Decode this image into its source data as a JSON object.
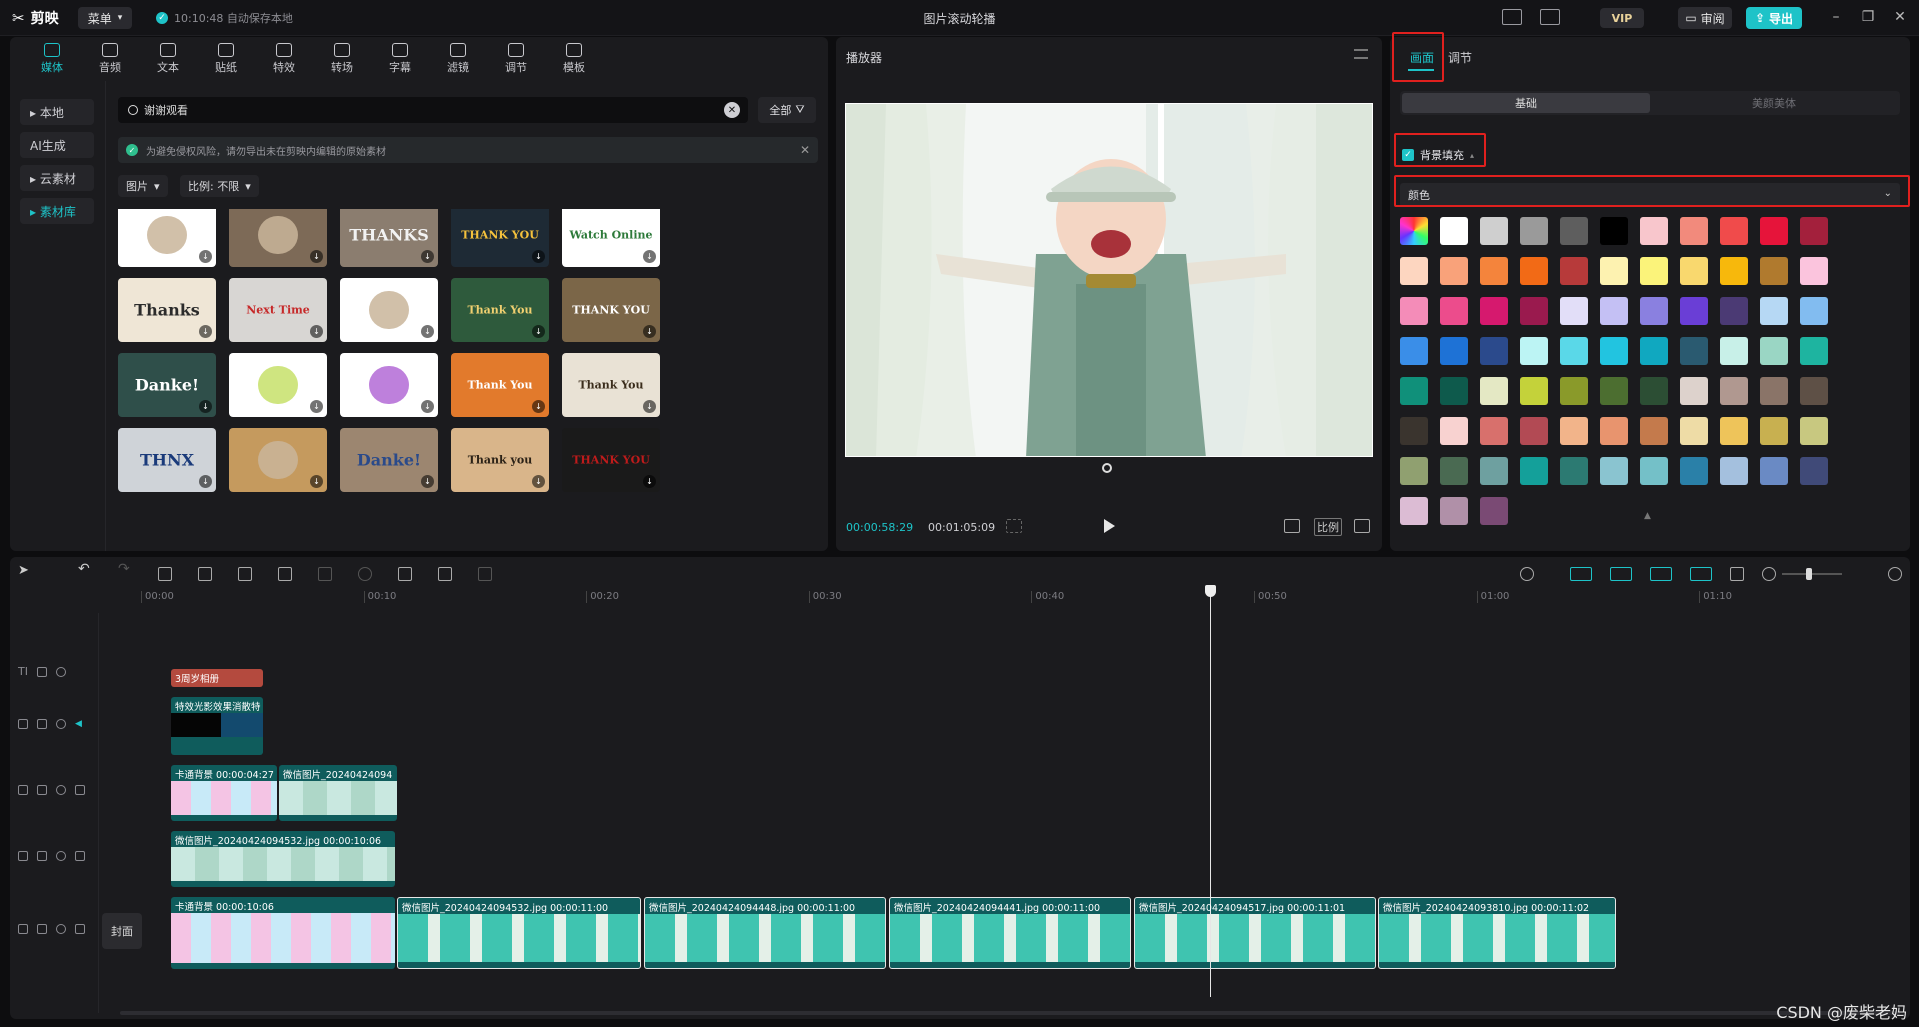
{
  "app": {
    "name": "剪映",
    "menu_label": "菜单",
    "autosave": "10:10:48 自动保存本地",
    "title": "图片滚动轮播",
    "vip": "VIP",
    "review": "审阅",
    "export": "导出"
  },
  "media": {
    "tabs": [
      {
        "label": "媒体",
        "active": true
      },
      {
        "label": "音频"
      },
      {
        "label": "文本"
      },
      {
        "label": "贴纸"
      },
      {
        "label": "特效"
      },
      {
        "label": "转场"
      },
      {
        "label": "字幕"
      },
      {
        "label": "滤镜"
      },
      {
        "label": "调节"
      },
      {
        "label": "模板"
      }
    ],
    "sidebar": [
      {
        "label": "▸ 本地"
      },
      {
        "label": "AI生成"
      },
      {
        "label": "▸ 云素材"
      },
      {
        "label": "▸ 素材库",
        "active": true
      }
    ],
    "search_value": "谢谢观看",
    "filter_all": "全部",
    "notice": "为避免侵权风险，请勿导出未在剪映内编辑的原始素材",
    "filter_type": "图片",
    "filter_ratio": "比例: 不限",
    "tiles": [
      {
        "text": "",
        "bg": "#ffffff"
      },
      {
        "text": "",
        "bg": "#7d6a57"
      },
      {
        "text": "THANKS",
        "bg": "#8b7d6f"
      },
      {
        "text": "THANK YOU",
        "bg": "#1e2a35"
      },
      {
        "text": "Watch Online",
        "bg": "#ffffff"
      },
      {
        "text": "Thanks",
        "bg": "#efe6d6"
      },
      {
        "text": "Next Time",
        "bg": "#d8d6d3"
      },
      {
        "text": "",
        "bg": "#ffffff"
      },
      {
        "text": "Thank You",
        "bg": "#2e5a3c"
      },
      {
        "text": "THANK YOU",
        "bg": "#7b6648"
      },
      {
        "text": "Danke!",
        "bg": "#2f4f4a"
      },
      {
        "text": "",
        "bg": "#ffffff"
      },
      {
        "text": "",
        "bg": "#ffffff"
      },
      {
        "text": "Thank You",
        "bg": "#e27a2c"
      },
      {
        "text": "Thank You",
        "bg": "#e9e2d5"
      },
      {
        "text": "THNX",
        "bg": "#cfd3d8"
      },
      {
        "text": "",
        "bg": "#c59a5e"
      },
      {
        "text": "Danke!",
        "bg": "#9c8670"
      },
      {
        "text": "Thank you",
        "bg": "#d9b58a"
      },
      {
        "text": "THANK YOU",
        "bg": "#1a1a1a"
      }
    ]
  },
  "player": {
    "title": "播放器",
    "current": "00:00:58:29",
    "total": "00:01:05:09",
    "ratio_label": "比例"
  },
  "props": {
    "tab_picture": "画面",
    "tab_adjust": "调节",
    "seg_basic": "基础",
    "seg_beauty": "美颜美体",
    "bgfill_label": "背景填充",
    "dropdown_value": "颜色",
    "swatches": [
      "#ffffff",
      "#cfcfcf",
      "#9a9a9a",
      "#5e5e5e",
      "#000000",
      "#f8c6cc",
      "#f28a7c",
      "#f04b4b",
      "#e6143a",
      "#a3203c",
      "#fdd6c0",
      "#f9a27a",
      "#f4843c",
      "#f26a16",
      "#b73a3a",
      "#fdf2b0",
      "#fbf37a",
      "#f9d86e",
      "#f7b80c",
      "#b07a2e",
      "#fbc4dd",
      "#f48cb8",
      "#ec4c8c",
      "#d6196e",
      "#9a1a4e",
      "#e2def8",
      "#c4c0f4",
      "#8a80e0",
      "#6a3ed6",
      "#4b3a74",
      "#b6d8f4",
      "#82bcf0",
      "#3a8ee8",
      "#1e72d6",
      "#2b4a8c",
      "#bcf4f4",
      "#5ad8e8",
      "#22c4e0",
      "#10a8c0",
      "#2a5a70",
      "#c8f0e8",
      "#9ad6c4",
      "#1eb4a0",
      "#10907a",
      "#0e5a4c",
      "#e4e8c4",
      "#c4d23a",
      "#8a9a2a",
      "#4c6e30",
      "#2c4e34",
      "#ddd2cc",
      "#b09890",
      "#8a7468",
      "#5e5046",
      "#3a342e",
      "#f8d2d0",
      "#d8706c",
      "#b24a54",
      "#f2b48a",
      "#e8946e",
      "#c47a4c",
      "#eedca6",
      "#eec45a",
      "#c8b050",
      "#c8c880",
      "#90a070",
      "#4a6a52",
      "#6ea0a0",
      "#14a09a",
      "#2c7a72",
      "#8ac4d0",
      "#74c0c8",
      "#2a80a8",
      "#a4c0de",
      "#6a8ac4",
      "#404a78",
      "#dcbcd4",
      "#b090a8",
      "#7a4a74"
    ]
  },
  "timeline": {
    "ruler": [
      "00:00",
      "00:10",
      "00:20",
      "00:30",
      "00:40",
      "00:50",
      "01:00",
      "01:10"
    ],
    "text_clip": "3周岁相册",
    "effect_clip": "特效光影效果消散特",
    "clips_track3": [
      {
        "label": "卡通背景  00:00:04:27"
      },
      {
        "label": "微信图片_20240424094"
      }
    ],
    "clips_track4": [
      {
        "label": "微信图片_20240424094532.jpg  00:00:10:06"
      }
    ],
    "clips_main": [
      {
        "label": "卡通背景  00:00:10:06"
      },
      {
        "label": "微信图片_20240424094532.jpg  00:00:11:00"
      },
      {
        "label": "微信图片_20240424094448.jpg  00:00:11:00"
      },
      {
        "label": "微信图片_20240424094441.jpg  00:00:11:00"
      },
      {
        "label": "微信图片_20240424094517.jpg  00:00:11:01"
      },
      {
        "label": "微信图片_20240424093810.jpg  00:00:11:02"
      }
    ],
    "cover_label": "封面"
  },
  "watermark": "CSDN @废柴老妈",
  "colors": {
    "accent": "#1ec3c8",
    "highlight": "#e0201e"
  }
}
